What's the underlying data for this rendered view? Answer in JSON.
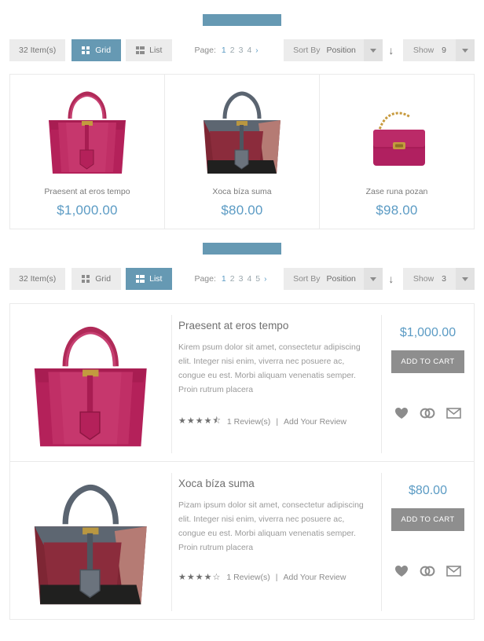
{
  "heading_bars": [
    {
      "name": "grid-section-heading-bar",
      "color": "#6699b3"
    },
    {
      "name": "list-section-heading-bar",
      "color": "#6699b3"
    }
  ],
  "toolbars": [
    {
      "item_count": "32 Item(s)",
      "grid_label": "Grid",
      "list_label": "List",
      "active_mode": "Grid",
      "page_label": "Page:",
      "pages": [
        "1",
        "2",
        "3",
        "4"
      ],
      "current_page": "1",
      "next_arrow": "›",
      "sort_by_label": "Sort By",
      "sort_by_value": "Position",
      "sort_direction_icon": "↓",
      "show_label": "Show",
      "show_value": "9"
    },
    {
      "item_count": "32 Item(s)",
      "grid_label": "Grid",
      "list_label": "List",
      "active_mode": "List",
      "page_label": "Page:",
      "pages": [
        "1",
        "2",
        "3",
        "4",
        "5"
      ],
      "current_page": "1",
      "next_arrow": "›",
      "sort_by_label": "Sort By",
      "sort_by_value": "Position",
      "sort_direction_icon": "↓",
      "show_label": "Show",
      "show_value": "3"
    }
  ],
  "grid_products": [
    {
      "name": "Praesent at eros tempo",
      "price": "$1,000.00",
      "image": "pink-tote-bag"
    },
    {
      "name": "Xoca bíza suma",
      "price": "$80.00",
      "image": "colorblock-tote-bag"
    },
    {
      "name": "Zase runa pozan",
      "price": "$98.00",
      "image": "magenta-chain-flap-bag"
    }
  ],
  "list_products": [
    {
      "name": "Praesent at eros tempo",
      "description": "Kirem psum dolor sit amet, consectetur adipiscing elit. Integer nisi enim, viverra nec posuere ac, congue eu est. Morbi aliquam venenatis semper. Proin rutrum placera",
      "price": "$1,000.00",
      "add_to_cart_label": "ADD TO CART",
      "rating_stars": 4.5,
      "rating_display": "★★★★⯪",
      "reviews_text": "1 Review(s)",
      "separator": "|",
      "add_review_text": "Add Your Review",
      "image": "pink-tote-bag",
      "actions": [
        "wishlist-heart-icon",
        "compare-icon",
        "email-icon"
      ]
    },
    {
      "name": "Xoca bíza suma",
      "description": "Pizam ipsum dolor sit amet, consectetur adipiscing elit. Integer nisi enim, viverra nec posuere ac, congue eu est. Morbi aliquam venenatis semper. Proin rutrum placera",
      "price": "$80.00",
      "add_to_cart_label": "ADD TO CART",
      "rating_stars": 4,
      "rating_display": "★★★★☆",
      "reviews_text": "1 Review(s)",
      "separator": "|",
      "add_review_text": "Add Your Review",
      "image": "colorblock-tote-bag",
      "actions": [
        "wishlist-heart-icon",
        "compare-icon",
        "email-icon"
      ]
    }
  ],
  "colors": {
    "accent_blue": "#5b9bc4",
    "active_button": "#6699b3",
    "toolbar_bg": "#ececec",
    "cart_button": "#8e8e8e",
    "border": "#eaeaea"
  }
}
